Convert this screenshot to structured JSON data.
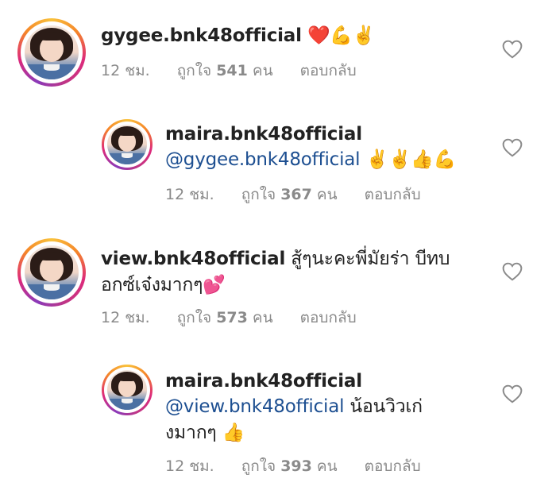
{
  "like_label": "ถูกใจ",
  "people_unit": "คน",
  "reply_label": "ตอบกลับ",
  "heart_icon": "heart-outline-icon",
  "comments": [
    {
      "username": "gygee.bnk48official",
      "text": "",
      "emoji": "❤️💪✌️",
      "time": "12 ชม.",
      "likes": "541"
    },
    {
      "username": "maira.bnk48official",
      "mention": "@gygee.bnk48official",
      "text": "",
      "emoji": "✌️✌️👍💪",
      "time": "12 ชม.",
      "likes": "367"
    },
    {
      "username": "view.bnk48official",
      "text_line1": "สู้ๆนะคะพี่มัยร่า บีทบ",
      "text_line2": "อกซ์เจ๋งมากๆ",
      "emoji": "💕",
      "time": "12 ชม.",
      "likes": "573"
    },
    {
      "username": "maira.bnk48official",
      "mention": "@view.bnk48official",
      "text_line1": " น้อนวิวเก่",
      "text_line2": "งมากๆ",
      "emoji": "👍",
      "time": "12 ชม.",
      "likes": "393"
    }
  ]
}
